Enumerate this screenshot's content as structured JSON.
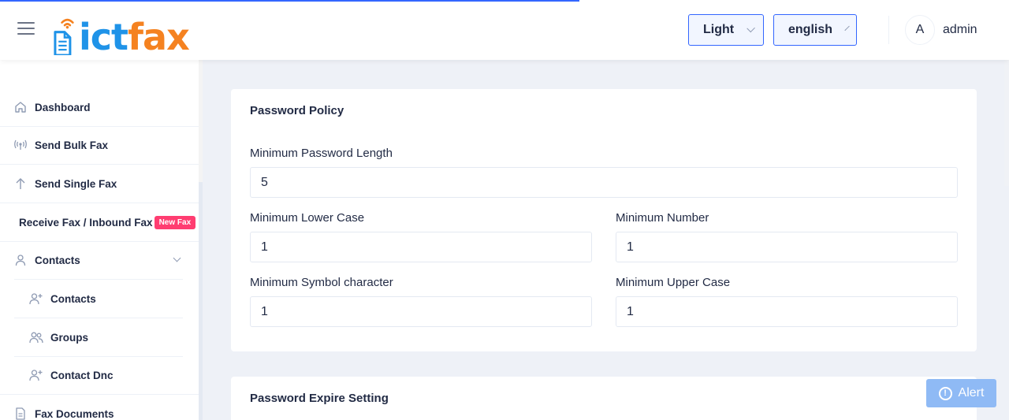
{
  "header": {
    "logo": {
      "part1": "ict",
      "part2": "fax"
    },
    "theme_select": {
      "value": "Light"
    },
    "language_select": {
      "value": "english"
    },
    "user": {
      "avatar_initial": "A",
      "name": "admin"
    }
  },
  "sidebar": {
    "items": [
      {
        "label": "Dashboard",
        "icon": "home-icon"
      },
      {
        "label": "Send Bulk Fax",
        "icon": "broadcast-icon"
      },
      {
        "label": "Send Single Fax",
        "icon": "arrow-up-icon"
      },
      {
        "label": "Receive Fax / Inbound Fax",
        "badge": "New Fax"
      },
      {
        "label": "Contacts",
        "icon": "person-icon",
        "expanded": true
      },
      {
        "label": "Contacts",
        "icon": "person-add-icon"
      },
      {
        "label": "Groups",
        "icon": "people-icon"
      },
      {
        "label": "Contact Dnc",
        "icon": "person-add-icon"
      },
      {
        "label": "Fax Documents",
        "icon": "file-icon"
      }
    ]
  },
  "main": {
    "password_policy": {
      "title": "Password Policy",
      "min_length_label": "Minimum Password Length",
      "min_length_value": "5",
      "min_lower_label": "Minimum Lower Case",
      "min_lower_value": "1",
      "min_number_label": "Minimum Number",
      "min_number_value": "1",
      "min_symbol_label": "Minimum Symbol character",
      "min_symbol_value": "1",
      "min_upper_label": "Minimum Upper Case",
      "min_upper_value": "1"
    },
    "password_expire": {
      "title": "Password Expire Setting"
    }
  },
  "alert_button": {
    "label": "Alert"
  },
  "colors": {
    "primary": "#3366ff",
    "logo_blue": "#1f93e8",
    "logo_orange": "#f58220",
    "badge": "#ff3d71",
    "alert": "#8fbaf5"
  }
}
